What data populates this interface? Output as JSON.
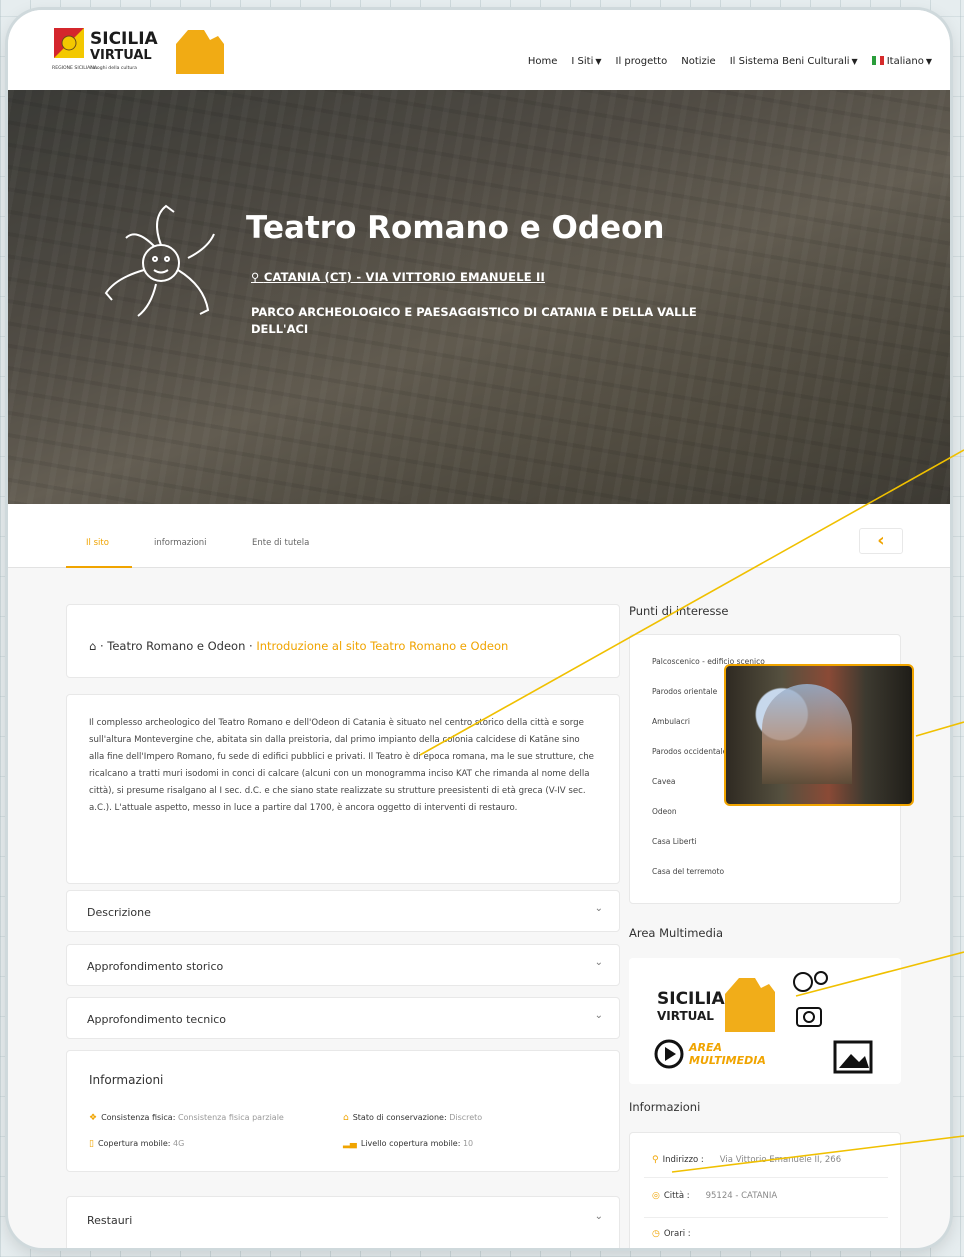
{
  "header": {
    "logo_brand_line1": "SICILIA",
    "logo_brand_line2": "VIRTUAL",
    "logo_region": "REGIONE SICILIANA",
    "logo_tag": "i luoghi della cultura",
    "nav": [
      {
        "label": "Home",
        "dropdown": false
      },
      {
        "label": "I Siti",
        "dropdown": true
      },
      {
        "label": "Il progetto",
        "dropdown": false
      },
      {
        "label": "Notizie",
        "dropdown": false
      },
      {
        "label": "Il Sistema Beni Culturali",
        "dropdown": true
      },
      {
        "label": "Italiano",
        "dropdown": true
      }
    ]
  },
  "hero": {
    "title": "Teatro Romano e Odeon",
    "location_icon": "map-pin-icon",
    "location": "CATANIA (CT) - VIA VITTORIO EMANUELE II",
    "park": "PARCO ARCHEOLOGICO E PAESAGGISTICO DI CATANIA E DELLA VALLE DELL'ACI"
  },
  "tabs": [
    "Il sito",
    "informazioni",
    "Ente di tutela"
  ],
  "back_glyph": "‹",
  "breadcrumb": {
    "home_icon": "home-icon",
    "item": "Teatro Romano e Odeon",
    "current": "Introduzione al sito Teatro Romano e Odeon"
  },
  "intro": "Il complesso archeologico del Teatro Romano e dell'Odeon di Catania è situato nel centro storico della città e sorge sull'altura Montevergine che, abitata sin dalla preistoria, dal primo impianto della colonia calcidese di Katāne sino alla fine dell'Impero Romano, fu sede di edifici pubblici e privati. Il Teatro è di epoca romana, ma le sue strutture, che ricalcano a tratti muri isodomi in conci di calcare (alcuni con un monogramma inciso KAT che rimanda al nome della città), si presume risalgano al I sec. d.C. e che siano state realizzate su strutture preesistenti di età greca (V-IV sec. a.C.). L'attuale aspetto, messo in luce a partire dal 1700, è ancora oggetto di interventi di restauro.",
  "accordions": [
    "Descrizione",
    "Approfondimento storico",
    "Approfondimento tecnico"
  ],
  "informazioni": {
    "title": "Informazioni",
    "items": [
      {
        "label": "Consistenza fisica:",
        "value": "Consistenza fisica parziale"
      },
      {
        "label": "Stato di conservazione:",
        "value": "Discreto"
      },
      {
        "label": "Copertura mobile:",
        "value": "4G"
      },
      {
        "label": "Livello copertura mobile:",
        "value": "10"
      }
    ]
  },
  "restauri": "Restauri",
  "sidebar": {
    "poi_title": "Punti di interesse",
    "poi": [
      "Palcoscenico - edificio scenico",
      "Parodos orientale",
      "Ambulacri",
      "Parodos occidentale",
      "Cavea",
      "Odeon",
      "Casa Liberti",
      "Casa del terremoto"
    ],
    "multimedia_title": "Area Multimedia",
    "multimedia_brand1": "SICILIA",
    "multimedia_brand2": "VIRTUAL",
    "multimedia_label1": "AREA",
    "multimedia_label2": "MULTIMEDIA",
    "info_title": "Informazioni",
    "address": [
      {
        "label": "Indirizzo :",
        "value": "Via Vittorio Emanuele II, 266"
      },
      {
        "label": "Città :",
        "value": "95124 - CATANIA"
      },
      {
        "label": "Orari :",
        "value": ""
      }
    ]
  },
  "colors": {
    "accent": "#f0a400",
    "hero_text": "#ffffff"
  }
}
